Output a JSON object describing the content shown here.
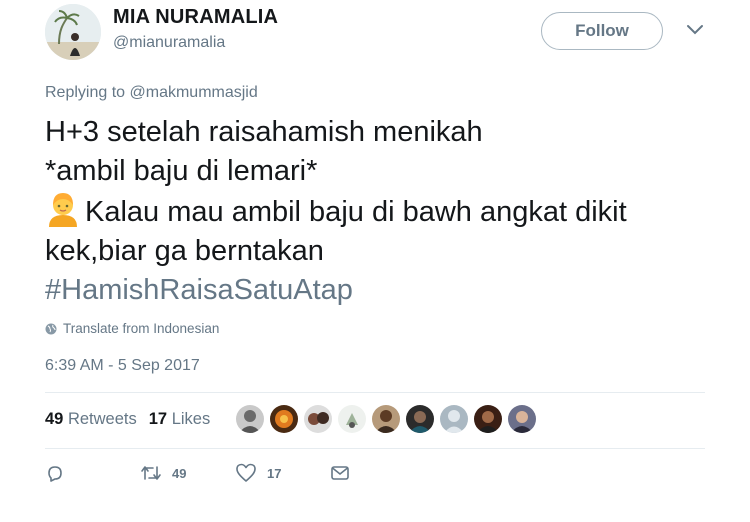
{
  "user": {
    "name": "MIA NURAMALIA",
    "handle": "@mianuramalia"
  },
  "follow_label": "Follow",
  "reply": {
    "prefix": "Replying to",
    "to": "@makmummasjid"
  },
  "tweet": {
    "line1": "H+3 setelah raisahamish menikah",
    "line2": "*ambil baju di lemari*",
    "line3": "Kalau mau ambil baju di bawh angkat dikit",
    "line4": "kek,biar ga berntakan",
    "hashtag": "#HamishRaisaSatuAtap"
  },
  "translate_label": "Translate from Indonesian",
  "timestamp": "6:39 AM - 5 Sep 2017",
  "stats": {
    "retweets_count": "49",
    "retweets_label": "Retweets",
    "likes_count": "17",
    "likes_label": "Likes"
  },
  "actions": {
    "retweet_count": "49",
    "like_count": "17"
  },
  "colors": {
    "text": "#14171a",
    "secondary": "#657786",
    "border": "#e6ecf0"
  }
}
